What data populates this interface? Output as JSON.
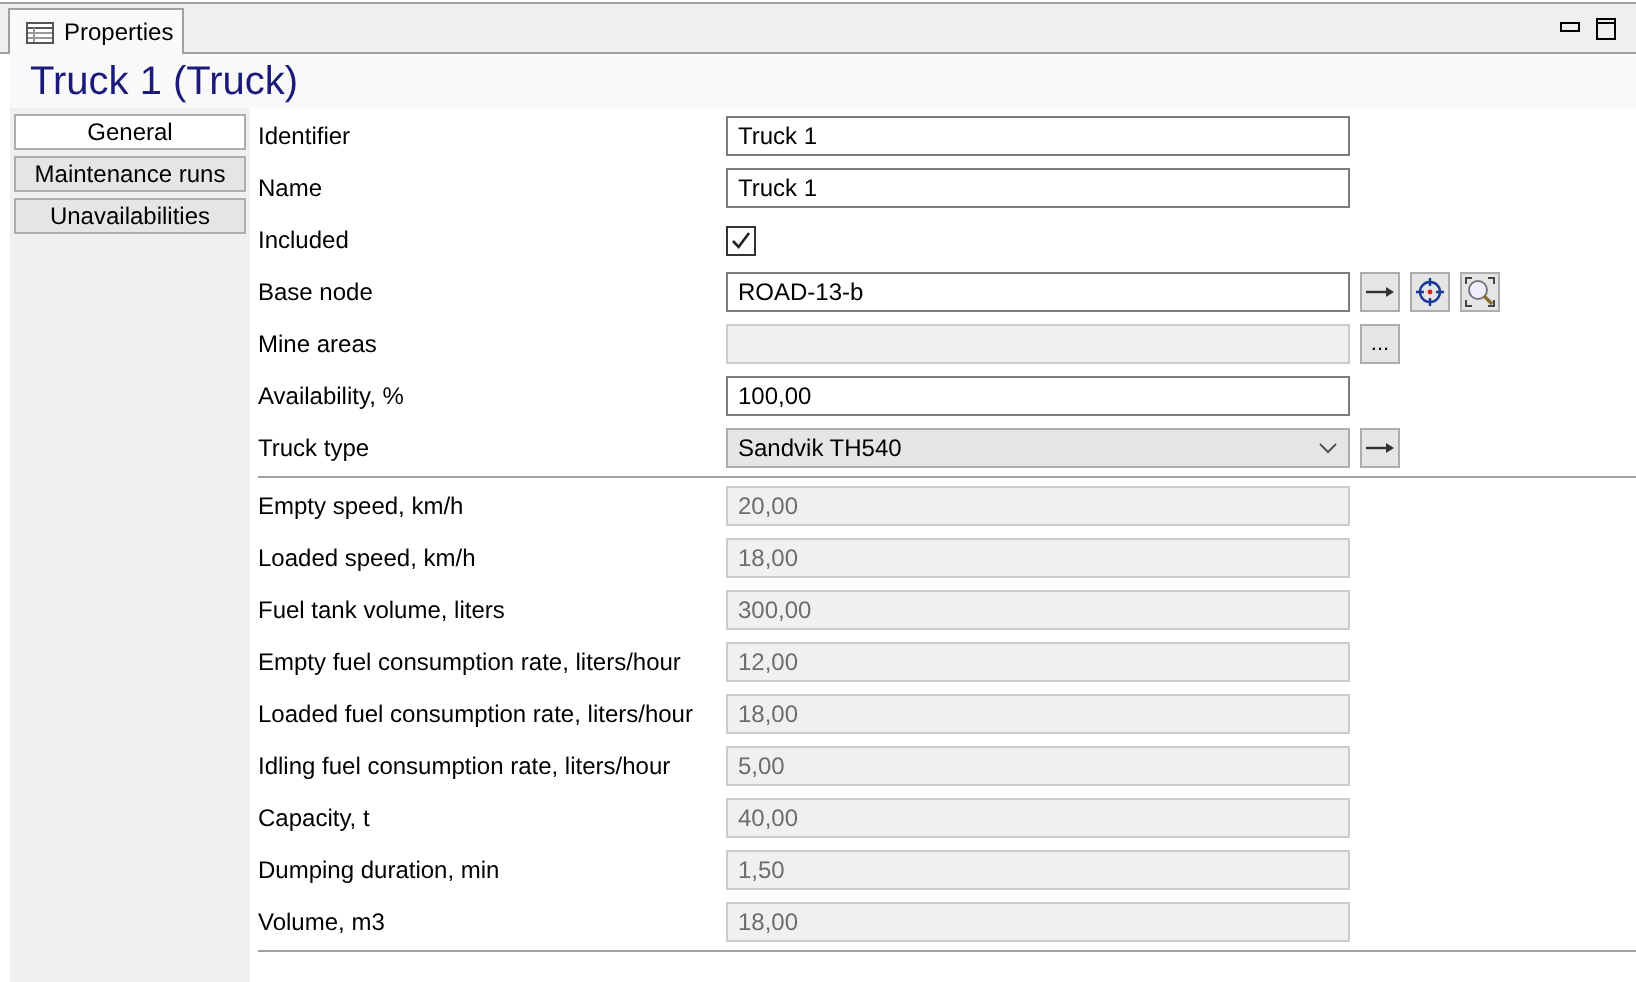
{
  "tab": {
    "label": "Properties",
    "selected": true
  },
  "title": "Truck 1 (Truck)",
  "nav": [
    {
      "label": "General",
      "selected": true
    },
    {
      "label": "Maintenance runs",
      "selected": false
    },
    {
      "label": "Unavailabilities",
      "selected": false
    }
  ],
  "sections": [
    {
      "fields": [
        {
          "label": "Identifier",
          "kind": "text",
          "value": "Truck 1",
          "disabled": false
        },
        {
          "label": "Name",
          "kind": "text",
          "value": "Truck 1",
          "disabled": false
        },
        {
          "label": "Included",
          "kind": "check",
          "checked": true
        },
        {
          "label": "Base node",
          "kind": "text",
          "value": "ROAD-13-b",
          "disabled": false,
          "actions": [
            {
              "kind": "go"
            },
            {
              "kind": "locate"
            },
            {
              "kind": "zoom"
            }
          ]
        },
        {
          "label": "Mine areas",
          "kind": "text",
          "disabled": true,
          "actions": [
            {
              "kind": "browse",
              "label": "..."
            }
          ]
        },
        {
          "label": "Availability, %",
          "kind": "text",
          "value": "100,00",
          "disabled": false
        },
        {
          "label": "Truck type",
          "kind": "combo",
          "value": "Sandvik TH540",
          "actions": [
            {
              "kind": "go"
            }
          ]
        }
      ]
    },
    {
      "fields": [
        {
          "label": "Empty speed, km/h",
          "kind": "text",
          "value": "20,00",
          "disabled": true
        },
        {
          "label": "Loaded speed, km/h",
          "kind": "text",
          "value": "18,00",
          "disabled": true
        },
        {
          "label": "Fuel tank volume, liters",
          "kind": "text",
          "value": "300,00",
          "disabled": true
        },
        {
          "label": "Empty fuel consumption rate, liters/hour",
          "kind": "text",
          "value": "12,00",
          "disabled": true
        },
        {
          "label": "Loaded fuel consumption rate, liters/hour",
          "kind": "text",
          "value": "18,00",
          "disabled": true
        },
        {
          "label": "Idling fuel consumption rate, liters/hour",
          "kind": "text",
          "value": "5,00",
          "disabled": true
        },
        {
          "label": "Capacity, t",
          "kind": "text",
          "value": "40,00",
          "disabled": true
        },
        {
          "label": "Dumping duration, min",
          "kind": "text",
          "value": "1,50",
          "disabled": true
        },
        {
          "label": "Volume, m3",
          "kind": "text",
          "value": "18,00",
          "disabled": true
        }
      ]
    }
  ]
}
